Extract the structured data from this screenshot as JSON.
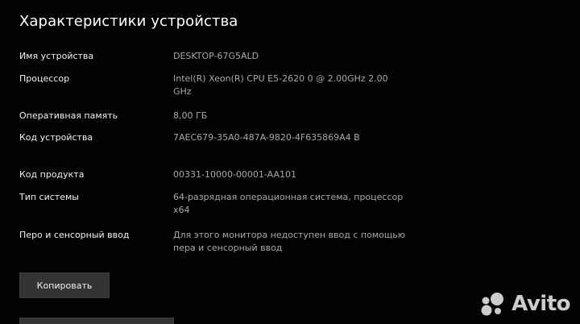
{
  "section": {
    "title": "Характеристики устройства"
  },
  "specs": [
    {
      "label": "Имя устройства",
      "value": "DESKTOP-67G5ALD"
    },
    {
      "label": "Процессор",
      "value": "Intel(R) Xeon(R) CPU E5-2620 0 @ 2.00GHz 2.00 GHz"
    },
    {
      "label": "Оперативная память",
      "value": "8,00 ГБ"
    },
    {
      "label": "Код устройства",
      "value": "7AEC679-35A0-487A-9820-4F635869A4 B"
    },
    {
      "label": "Код продукта",
      "value": "00331-10000-00001-AA101"
    },
    {
      "label": "Тип системы",
      "value": "64-разрядная операционная система, процессор x64"
    },
    {
      "label": "Перо и сенсорный ввод",
      "value": "Для этого монитора недоступен ввод с помощью пера и сенсорный ввод"
    }
  ],
  "buttons": {
    "copy_label": "Копировать"
  },
  "watermark": {
    "icon": "avito-dots-icon",
    "text": "Avito"
  },
  "colors": {
    "background": "#020202",
    "label": "#f2f2f2",
    "value": "#a9a9a9",
    "button_bg": "#333333"
  }
}
